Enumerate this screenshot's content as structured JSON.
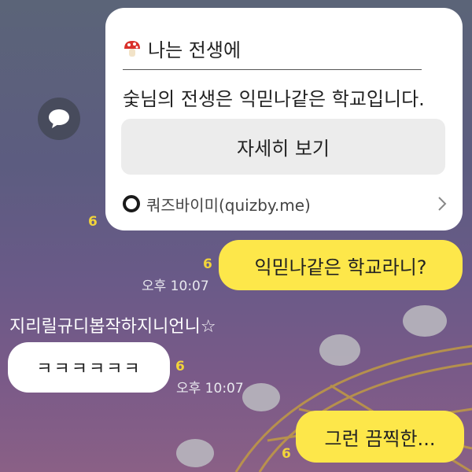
{
  "card": {
    "title": "나는 전생에",
    "description": "숯님의 전생은 익믿나같은 학교입니다.",
    "detail_button": "자세히 보기",
    "source": "쿼즈바이미(quizby.me)",
    "icon": "mushroom-icon"
  },
  "messages": {
    "out1": {
      "text": "익믿나같은 학교라니?",
      "unread": "6",
      "time": "오후 10:07"
    },
    "card_unread": "6",
    "sender_name": "지리릴규디봅작하지니언니☆",
    "in1": {
      "text": "ㅋㅋㅋㅋㅋㅋ",
      "unread": "6",
      "time": "오후 10:07"
    },
    "out2": {
      "text": "그런 끔찍한...",
      "unread": "6"
    }
  },
  "colors": {
    "outgoing_bubble": "#fde74a",
    "incoming_bubble": "#ffffff",
    "unread": "#f2d43a"
  }
}
